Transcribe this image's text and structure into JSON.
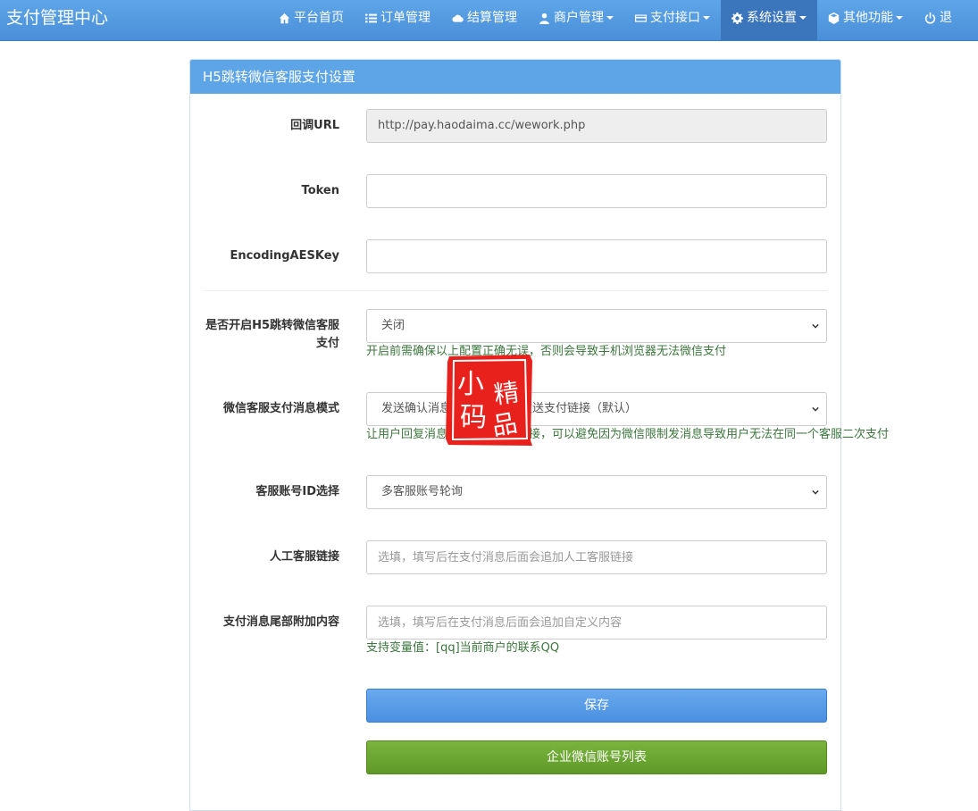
{
  "brand": "支付管理中心",
  "nav": [
    {
      "label": "平台首页",
      "icon": "home-icon",
      "caret": false,
      "active": false
    },
    {
      "label": "订单管理",
      "icon": "list-icon",
      "caret": false,
      "active": false
    },
    {
      "label": "结算管理",
      "icon": "cloud-icon",
      "caret": false,
      "active": false
    },
    {
      "label": "商户管理",
      "icon": "user-icon",
      "caret": true,
      "active": false
    },
    {
      "label": "支付接口",
      "icon": "card-icon",
      "caret": true,
      "active": false
    },
    {
      "label": "系统设置",
      "icon": "gear-icon",
      "caret": true,
      "active": true
    },
    {
      "label": "其他功能",
      "icon": "cube-icon",
      "caret": true,
      "active": false
    },
    {
      "label": "退",
      "icon": "power-icon",
      "caret": false,
      "active": false
    }
  ],
  "panel": {
    "title": "H5跳转微信客服支付设置"
  },
  "form": {
    "callback_url": {
      "label": "回调URL",
      "value": "http://pay.haodaima.cc/wework.php"
    },
    "token": {
      "label": "Token",
      "value": ""
    },
    "aes_key": {
      "label": "EncodingAESKey",
      "value": ""
    },
    "enable": {
      "label": "是否开启H5跳转微信客服支付",
      "value": "关闭",
      "help": "开启前需确保以上配置正确无误，否则会导致手机浏览器无法微信支付"
    },
    "msg_mode": {
      "label": "微信客服支付消息模式",
      "value": "发送确认消息，用户回复后发送支付链接（默认）",
      "help": "让用户回复消息后再发送支付链接，可以避免因为微信限制发消息导致用户无法在同一个客服二次支付"
    },
    "account_id": {
      "label": "客服账号ID选择",
      "value": "多客服账号轮询"
    },
    "manual_link": {
      "label": "人工客服链接",
      "placeholder": "选填，填写后在支付消息后面会追加人工客服链接"
    },
    "tail_content": {
      "label": "支付消息尾部附加内容",
      "placeholder": "选填，填写后在支付消息后面会追加自定义内容",
      "help": "支持变量值：[qq]当前商户的联系QQ"
    }
  },
  "buttons": {
    "save": "保存",
    "account_list": "企业微信账号列表"
  },
  "stamp": {
    "chars": [
      "小",
      "精",
      "码",
      "品"
    ],
    "color": "#e8211c"
  },
  "colors": {
    "navbar": "#5ea5e8",
    "nav_active": "#3b76bd",
    "primary": "#4a8fe0",
    "success": "#5f9a28",
    "help_text": "#3c763d"
  }
}
